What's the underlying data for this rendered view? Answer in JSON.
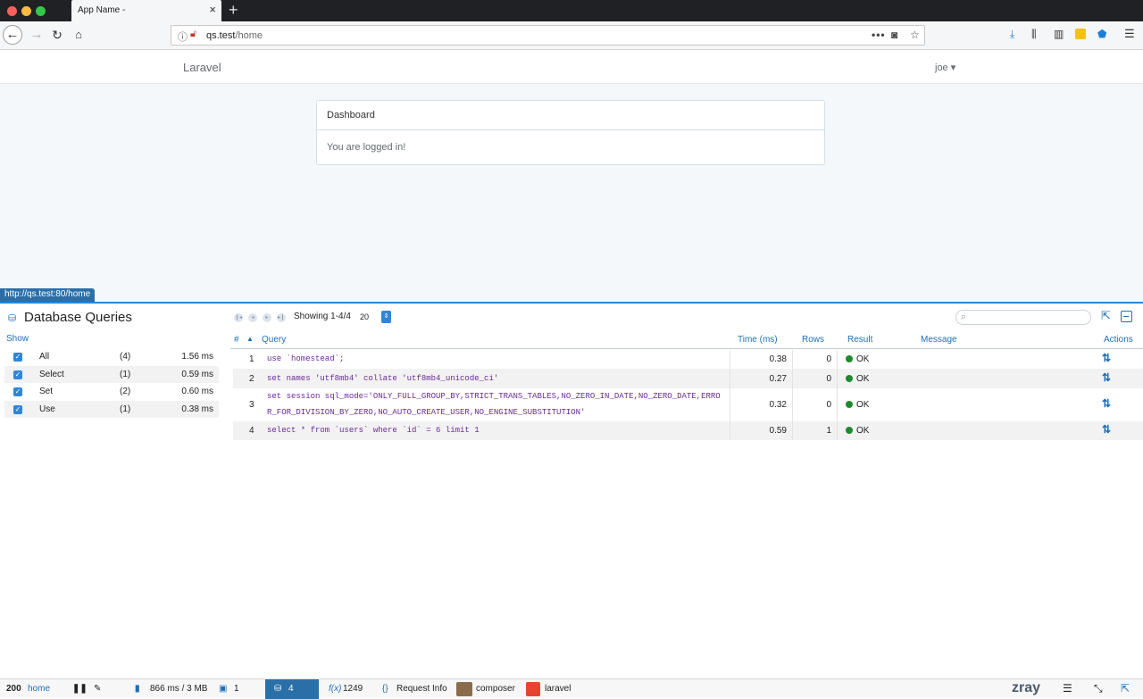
{
  "browser": {
    "tab_title": "App Name -",
    "tab_close": "×",
    "new_tab": "+",
    "url_host": "qs.test",
    "url_path": "/home"
  },
  "app": {
    "brand": "Laravel",
    "user_menu": "joe ▾",
    "card_title": "Dashboard",
    "card_body": "You are logged in!",
    "status_url": "http://qs.test:80/home"
  },
  "panel": {
    "title": "Database Queries",
    "showing": "Showing 1-4/4",
    "per_page": "20",
    "show_label": "Show",
    "filters": [
      {
        "name": "All",
        "count": "(4)",
        "time": "1.56 ms"
      },
      {
        "name": "Select",
        "count": "(1)",
        "time": "0.59 ms"
      },
      {
        "name": "Set",
        "count": "(2)",
        "time": "0.60 ms"
      },
      {
        "name": "Use",
        "count": "(1)",
        "time": "0.38 ms"
      }
    ],
    "columns": {
      "num": "#",
      "query": "Query",
      "time": "Time (ms)",
      "rows": "Rows",
      "result": "Result",
      "message": "Message",
      "actions": "Actions"
    },
    "queries": [
      {
        "num": "1",
        "sql": "use `homestead`;",
        "time": "0.38",
        "rows": "0",
        "result": "OK"
      },
      {
        "num": "2",
        "sql": "set names 'utf8mb4' collate 'utf8mb4_unicode_ci'",
        "time": "0.27",
        "rows": "0",
        "result": "OK"
      },
      {
        "num": "3",
        "sql": "set session sql_mode='ONLY_FULL_GROUP_BY,STRICT_TRANS_TABLES,NO_ZERO_IN_DATE,NO_ZERO_DATE,ERROR_FOR_DIVISION_BY_ZERO,NO_AUTO_CREATE_USER,NO_ENGINE_SUBSTITUTION'",
        "time": "0.32",
        "rows": "0",
        "result": "OK"
      },
      {
        "num": "4",
        "sql": "select * from `users` where `id` = 6 limit 1",
        "time": "0.59",
        "rows": "1",
        "result": "OK"
      }
    ]
  },
  "zbar": {
    "status": "200",
    "route": "home",
    "perf": "866 ms / 3 MB",
    "pages": "1",
    "queries": "4",
    "functions": "1249",
    "request_info": "Request Info",
    "composer": "composer",
    "laravel": "laravel",
    "brand": "zray"
  },
  "colors": {
    "accent": "#1d6fb8",
    "ok": "#1e8a2d",
    "sql_keyword": "#6b2a9a",
    "sql_string": "#7a8a00"
  }
}
